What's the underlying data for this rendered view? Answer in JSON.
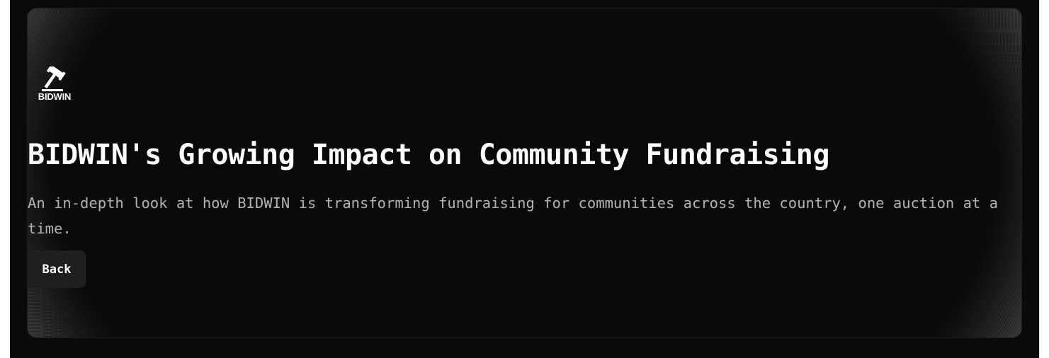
{
  "hero": {
    "logo_text": "BIDWIN",
    "logo_icon": "gavel-icon",
    "title": "BIDWIN's Growing Impact on Community Fundraising",
    "subtitle": "An in-depth look at how BIDWIN is transforming fundraising for communities across the country, one auction at a time.",
    "back_label": "Back"
  },
  "colors": {
    "background": "#0a0a0a",
    "title": "#ffffff",
    "subtitle": "#b3b3b3",
    "button_bg": "#1f1f1f"
  }
}
